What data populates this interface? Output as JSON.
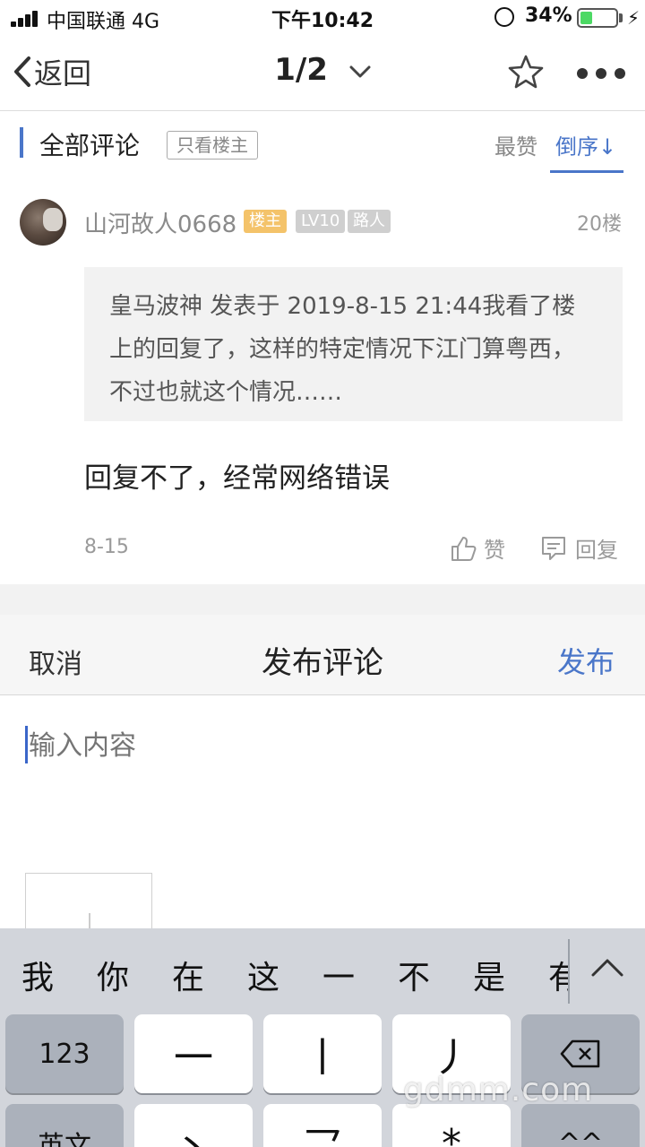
{
  "status_bar": {
    "carrier": "中国联通  4G",
    "time": "下午10:42",
    "battery_percent": "34%",
    "battery_level": 0.34
  },
  "nav": {
    "back_label": "返回",
    "page_indicator": "1/2"
  },
  "comments_header": {
    "title": "全部评论",
    "only_op_label": "只看楼主",
    "sort_top_label": "最赞",
    "sort_desc_label": "倒序↓"
  },
  "comment": {
    "username": "山河故人0668",
    "badge_op": "楼主",
    "badge_level": "LV10",
    "badge_role": "路人",
    "floor": "20楼",
    "quote": "皇马波神 发表于 2019-8-15 21:44我看了楼上的回复了，这样的特定情况下江门算粤西，不过也就这个情况……",
    "text": "回复不了，经常网络错误",
    "date": "8-15",
    "like_label": "赞",
    "reply_label": "回复"
  },
  "compose": {
    "cancel_label": "取消",
    "title": "发布评论",
    "publish_label": "发布",
    "placeholder": "输入内容"
  },
  "keyboard": {
    "candidates": [
      "我",
      "你",
      "在",
      "这",
      "一",
      "不",
      "是",
      "有"
    ],
    "keys_row1": [
      "123",
      "一",
      "丨",
      "丿"
    ],
    "keys_row2": [
      "英文",
      "丶",
      "乛",
      "*",
      "^^"
    ]
  },
  "watermark": "gdmm.com",
  "colors": {
    "accent": "#4a76c9",
    "badge_op": "#f4c36a",
    "badge_grey": "#cfcfcf",
    "battery": "#4cd964"
  }
}
